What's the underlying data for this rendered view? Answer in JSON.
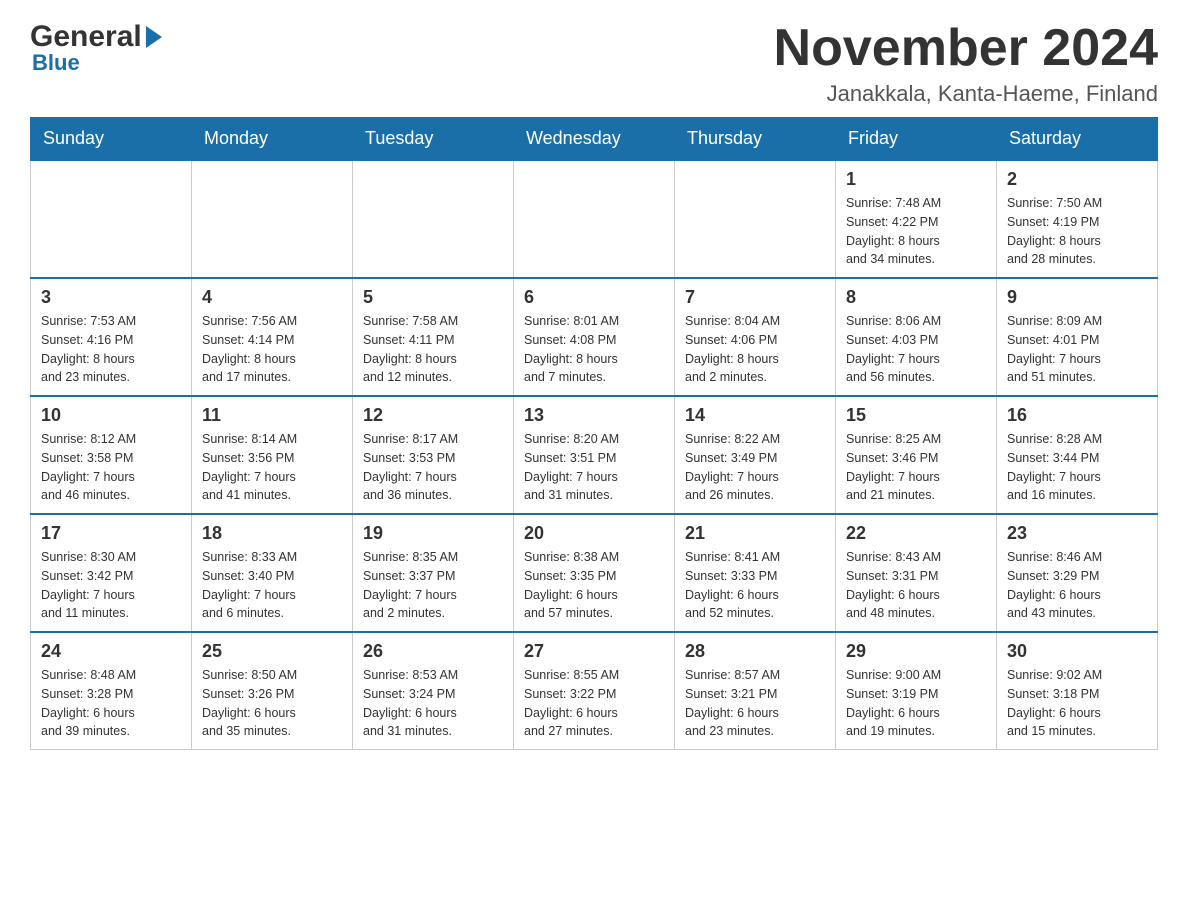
{
  "logo": {
    "text_general": "General",
    "text_blue": "Blue",
    "triangle_color": "#1a6fa8"
  },
  "header": {
    "month_title": "November 2024",
    "location": "Janakkala, Kanta-Haeme, Finland"
  },
  "weekdays": [
    "Sunday",
    "Monday",
    "Tuesday",
    "Wednesday",
    "Thursday",
    "Friday",
    "Saturday"
  ],
  "weeks": [
    {
      "days": [
        {
          "date": "",
          "info": ""
        },
        {
          "date": "",
          "info": ""
        },
        {
          "date": "",
          "info": ""
        },
        {
          "date": "",
          "info": ""
        },
        {
          "date": "",
          "info": ""
        },
        {
          "date": "1",
          "info": "Sunrise: 7:48 AM\nSunset: 4:22 PM\nDaylight: 8 hours\nand 34 minutes."
        },
        {
          "date": "2",
          "info": "Sunrise: 7:50 AM\nSunset: 4:19 PM\nDaylight: 8 hours\nand 28 minutes."
        }
      ]
    },
    {
      "days": [
        {
          "date": "3",
          "info": "Sunrise: 7:53 AM\nSunset: 4:16 PM\nDaylight: 8 hours\nand 23 minutes."
        },
        {
          "date": "4",
          "info": "Sunrise: 7:56 AM\nSunset: 4:14 PM\nDaylight: 8 hours\nand 17 minutes."
        },
        {
          "date": "5",
          "info": "Sunrise: 7:58 AM\nSunset: 4:11 PM\nDaylight: 8 hours\nand 12 minutes."
        },
        {
          "date": "6",
          "info": "Sunrise: 8:01 AM\nSunset: 4:08 PM\nDaylight: 8 hours\nand 7 minutes."
        },
        {
          "date": "7",
          "info": "Sunrise: 8:04 AM\nSunset: 4:06 PM\nDaylight: 8 hours\nand 2 minutes."
        },
        {
          "date": "8",
          "info": "Sunrise: 8:06 AM\nSunset: 4:03 PM\nDaylight: 7 hours\nand 56 minutes."
        },
        {
          "date": "9",
          "info": "Sunrise: 8:09 AM\nSunset: 4:01 PM\nDaylight: 7 hours\nand 51 minutes."
        }
      ]
    },
    {
      "days": [
        {
          "date": "10",
          "info": "Sunrise: 8:12 AM\nSunset: 3:58 PM\nDaylight: 7 hours\nand 46 minutes."
        },
        {
          "date": "11",
          "info": "Sunrise: 8:14 AM\nSunset: 3:56 PM\nDaylight: 7 hours\nand 41 minutes."
        },
        {
          "date": "12",
          "info": "Sunrise: 8:17 AM\nSunset: 3:53 PM\nDaylight: 7 hours\nand 36 minutes."
        },
        {
          "date": "13",
          "info": "Sunrise: 8:20 AM\nSunset: 3:51 PM\nDaylight: 7 hours\nand 31 minutes."
        },
        {
          "date": "14",
          "info": "Sunrise: 8:22 AM\nSunset: 3:49 PM\nDaylight: 7 hours\nand 26 minutes."
        },
        {
          "date": "15",
          "info": "Sunrise: 8:25 AM\nSunset: 3:46 PM\nDaylight: 7 hours\nand 21 minutes."
        },
        {
          "date": "16",
          "info": "Sunrise: 8:28 AM\nSunset: 3:44 PM\nDaylight: 7 hours\nand 16 minutes."
        }
      ]
    },
    {
      "days": [
        {
          "date": "17",
          "info": "Sunrise: 8:30 AM\nSunset: 3:42 PM\nDaylight: 7 hours\nand 11 minutes."
        },
        {
          "date": "18",
          "info": "Sunrise: 8:33 AM\nSunset: 3:40 PM\nDaylight: 7 hours\nand 6 minutes."
        },
        {
          "date": "19",
          "info": "Sunrise: 8:35 AM\nSunset: 3:37 PM\nDaylight: 7 hours\nand 2 minutes."
        },
        {
          "date": "20",
          "info": "Sunrise: 8:38 AM\nSunset: 3:35 PM\nDaylight: 6 hours\nand 57 minutes."
        },
        {
          "date": "21",
          "info": "Sunrise: 8:41 AM\nSunset: 3:33 PM\nDaylight: 6 hours\nand 52 minutes."
        },
        {
          "date": "22",
          "info": "Sunrise: 8:43 AM\nSunset: 3:31 PM\nDaylight: 6 hours\nand 48 minutes."
        },
        {
          "date": "23",
          "info": "Sunrise: 8:46 AM\nSunset: 3:29 PM\nDaylight: 6 hours\nand 43 minutes."
        }
      ]
    },
    {
      "days": [
        {
          "date": "24",
          "info": "Sunrise: 8:48 AM\nSunset: 3:28 PM\nDaylight: 6 hours\nand 39 minutes."
        },
        {
          "date": "25",
          "info": "Sunrise: 8:50 AM\nSunset: 3:26 PM\nDaylight: 6 hours\nand 35 minutes."
        },
        {
          "date": "26",
          "info": "Sunrise: 8:53 AM\nSunset: 3:24 PM\nDaylight: 6 hours\nand 31 minutes."
        },
        {
          "date": "27",
          "info": "Sunrise: 8:55 AM\nSunset: 3:22 PM\nDaylight: 6 hours\nand 27 minutes."
        },
        {
          "date": "28",
          "info": "Sunrise: 8:57 AM\nSunset: 3:21 PM\nDaylight: 6 hours\nand 23 minutes."
        },
        {
          "date": "29",
          "info": "Sunrise: 9:00 AM\nSunset: 3:19 PM\nDaylight: 6 hours\nand 19 minutes."
        },
        {
          "date": "30",
          "info": "Sunrise: 9:02 AM\nSunset: 3:18 PM\nDaylight: 6 hours\nand 15 minutes."
        }
      ]
    }
  ]
}
